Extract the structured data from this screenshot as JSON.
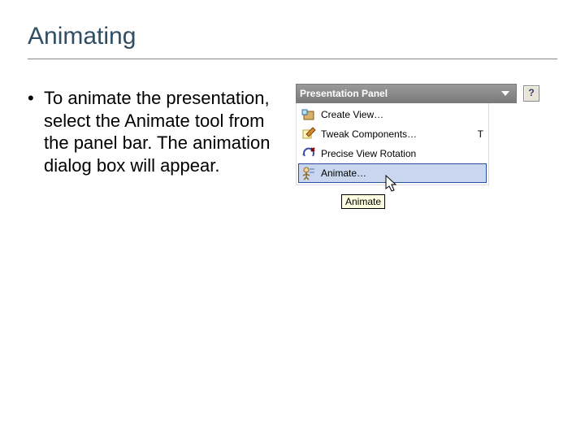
{
  "slide": {
    "title": "Animating",
    "bullets": [
      "To animate the presentation, select the  Animate tool from the panel bar. The animation dialog box will appear."
    ]
  },
  "panel": {
    "title": "Presentation Panel",
    "help_label": "?",
    "items": [
      {
        "label": "Create View…",
        "shortcut": "",
        "state": "normal"
      },
      {
        "label": "Tweak Components…",
        "shortcut": "T",
        "state": "normal"
      },
      {
        "label": "Precise View Rotation",
        "shortcut": "",
        "state": "normal"
      },
      {
        "label": "Animate…",
        "shortcut": "",
        "state": "hover"
      }
    ],
    "tooltip": "Animate"
  }
}
